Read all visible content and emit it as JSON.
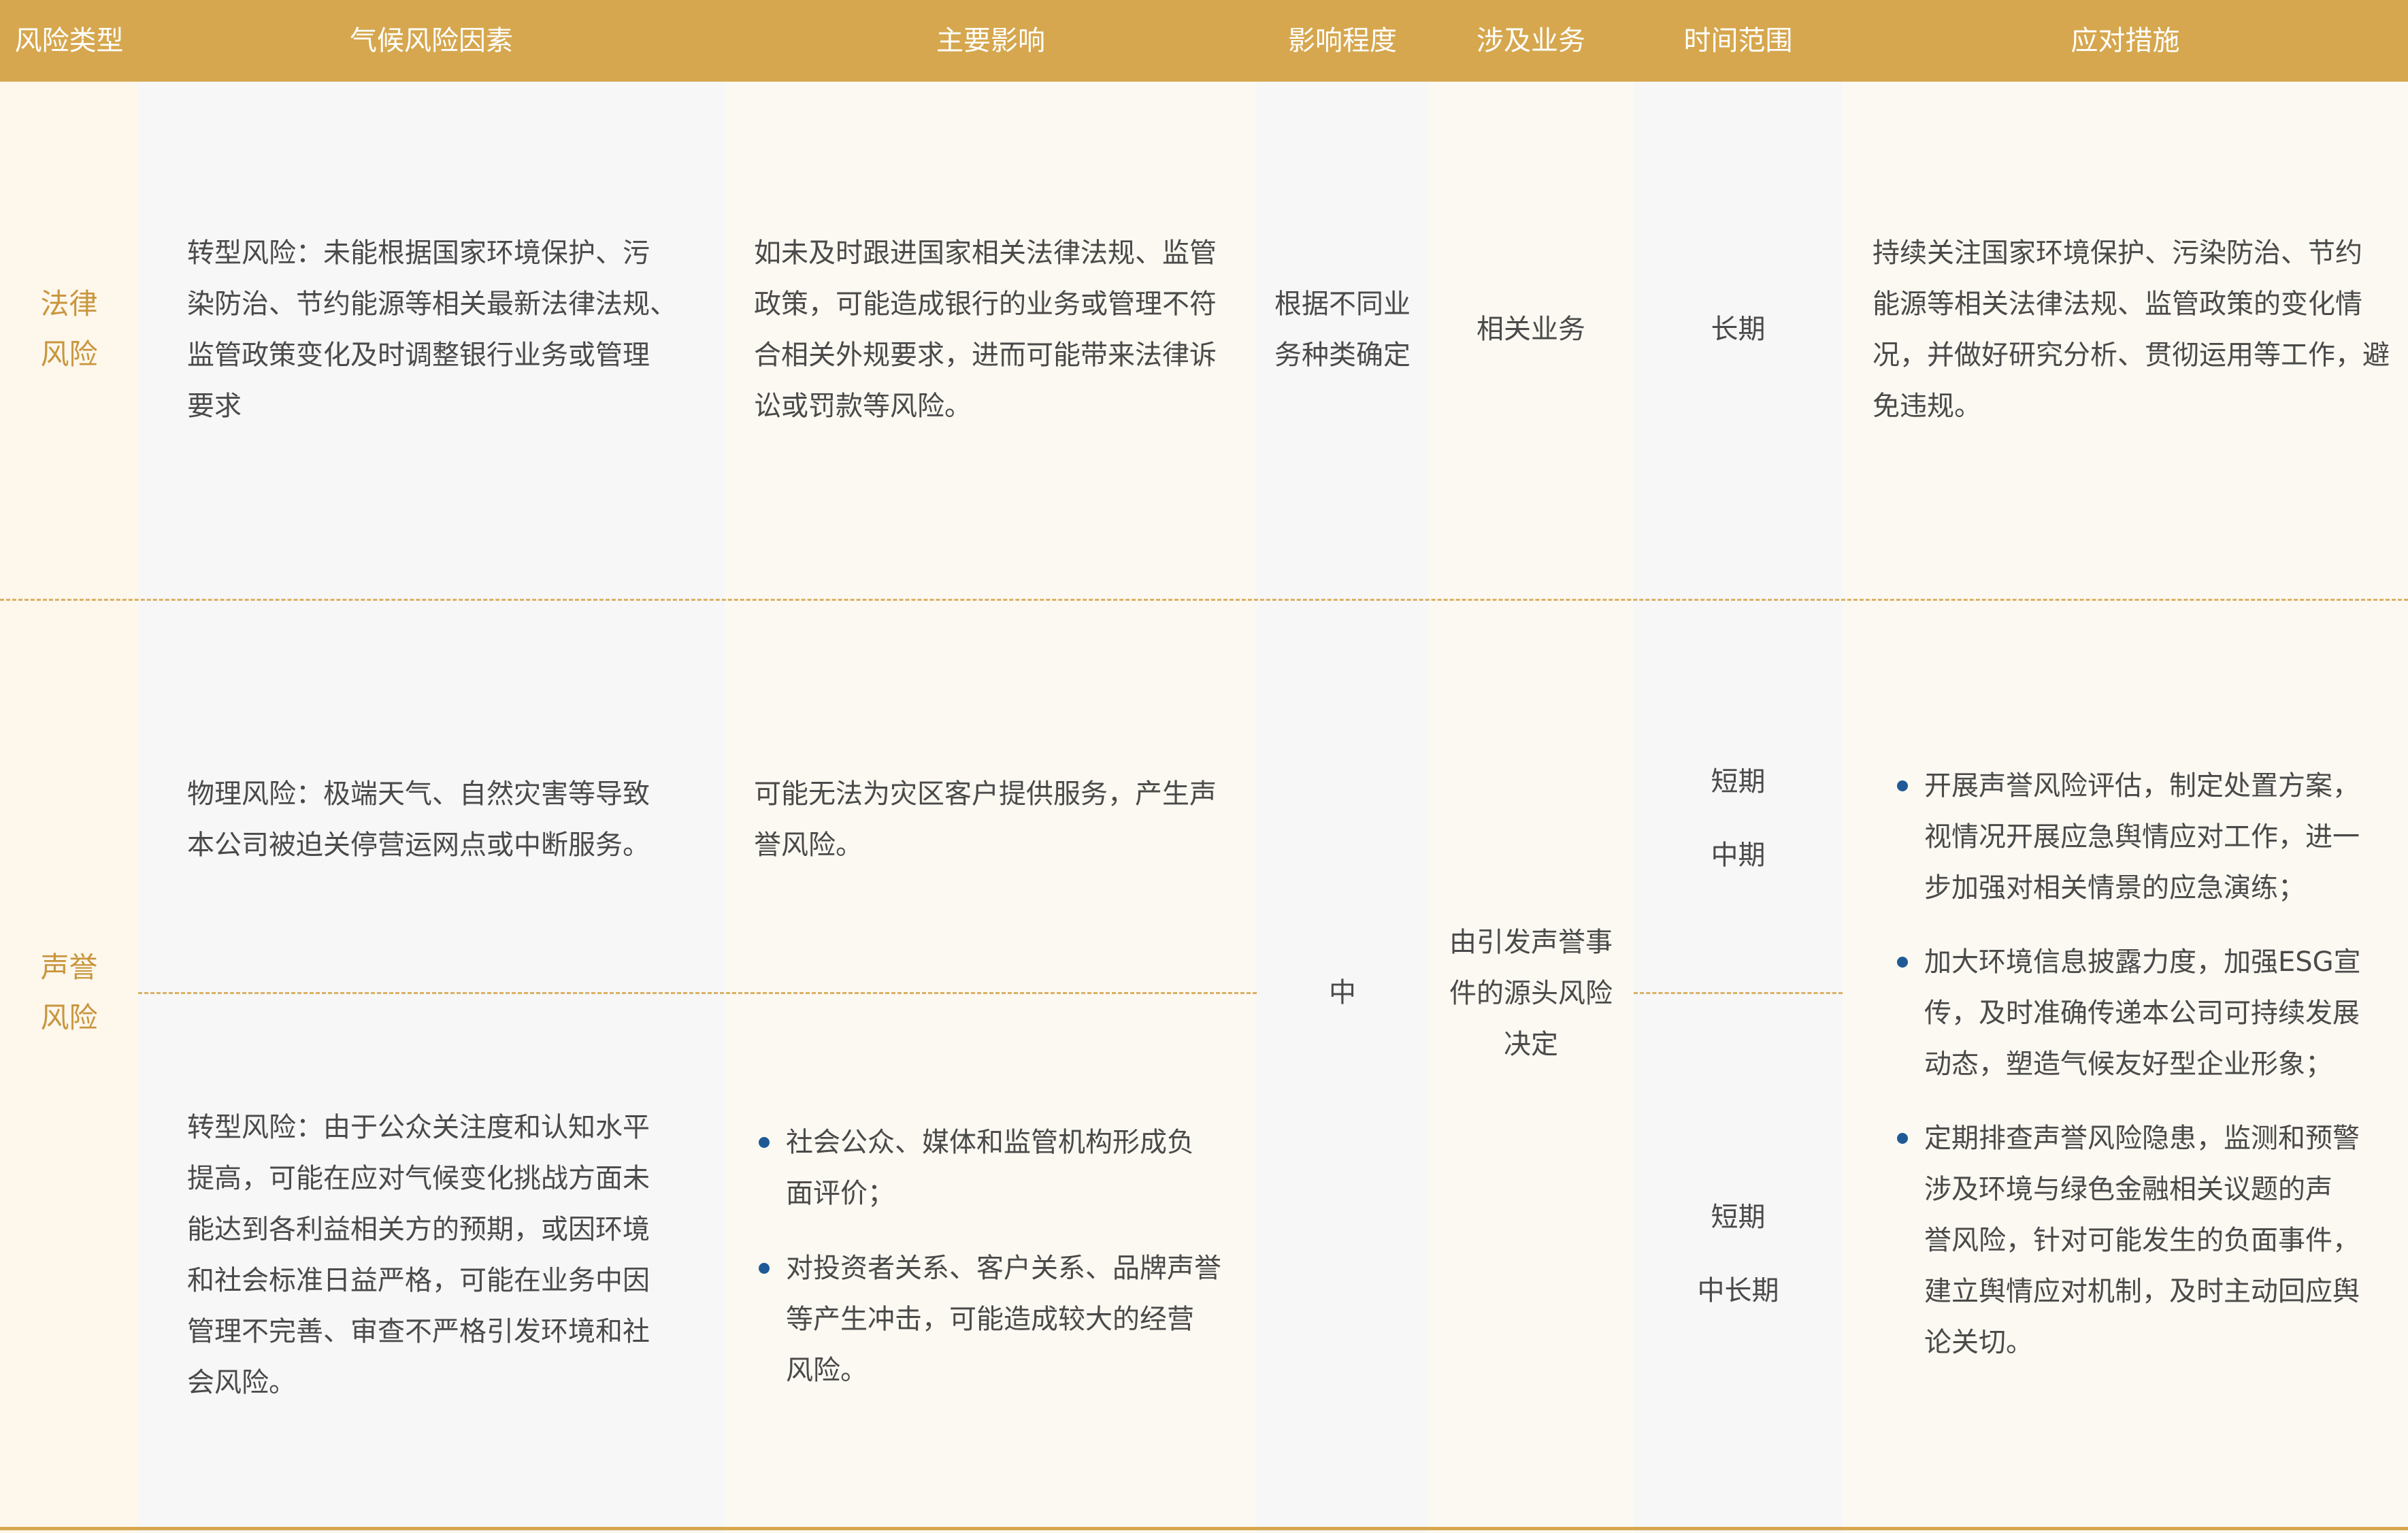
{
  "colors": {
    "header_bg": "#d6a74e",
    "header_text": "#ffffff",
    "type_col_bg": "#fdf7ec",
    "light_col_bg": "#f7f7f8",
    "cream_col_bg": "#fcf9f2",
    "type_text": "#c9963e",
    "bullet": "#1f5a96"
  },
  "header": {
    "type": "风险类型",
    "factors": "气候风险因素",
    "impact": "主要影响",
    "degree": "影响程度",
    "business": "涉及业务",
    "time": "时间范围",
    "measures": "应对措施"
  },
  "legal": {
    "type": "法律\n风险",
    "factor": "转型风险：未能根据国家环境保护、污\n染防治、节约能源等相关最新法律法规、\n监管政策变化及时调整银行业务或管理\n要求",
    "impact": "如未及时跟进国家相关法律法规、监管\n政策，可能造成银行的业务或管理不符\n合相关外规要求，进而可能带来法律诉\n讼或罚款等风险。",
    "degree": "根据不同业\n务种类确定",
    "business": "相关业务",
    "time": "长期",
    "measure": "持续关注国家环境保护、污染防治、节约\n能源等相关法律法规、监管政策的变化情\n况，并做好研究分析、贯彻运用等工作，避\n免违规。"
  },
  "reputation": {
    "type": "声誉\n风险",
    "physical_factor": "物理风险：极端天气、自然灾害等导致\n本公司被迫关停营运网点或中断服务。",
    "physical_impact": "可能无法为灾区客户提供服务，产生声\n誉风险。",
    "physical_time_1": "短期",
    "physical_time_2": "中期",
    "transition_factor": "转型风险：由于公众关注度和认知水平\n提高，可能在应对气候变化挑战方面未\n能达到各利益相关方的预期，或因环境\n和社会标准日益严格，可能在业务中因\n管理不完善、审查不严格引发环境和社\n会风险。",
    "transition_impacts": [
      "社会公众、媒体和监管机构形成负\n面评价；",
      "对投资者关系、客户关系、品牌声誉\n等产生冲击，可能造成较大的经营\n风险。"
    ],
    "transition_time_1": "短期",
    "transition_time_2": "中长期",
    "degree": "中",
    "business": "由引发声誉事\n件的源头风险\n决定",
    "measures": [
      "开展声誉风险评估，制定处置方案，\n视情况开展应急舆情应对工作，进一\n步加强对相关情景的应急演练；",
      "加大环境信息披露力度，加强ESG宣\n传，及时准确传递本公司可持续发展\n动态，塑造气候友好型企业形象；",
      "定期排查声誉风险隐患，监测和预警\n涉及环境与绿色金融相关议题的声\n誉风险，针对可能发生的负面事件，\n建立舆情应对机制，及时主动回应舆\n论关切。"
    ]
  }
}
